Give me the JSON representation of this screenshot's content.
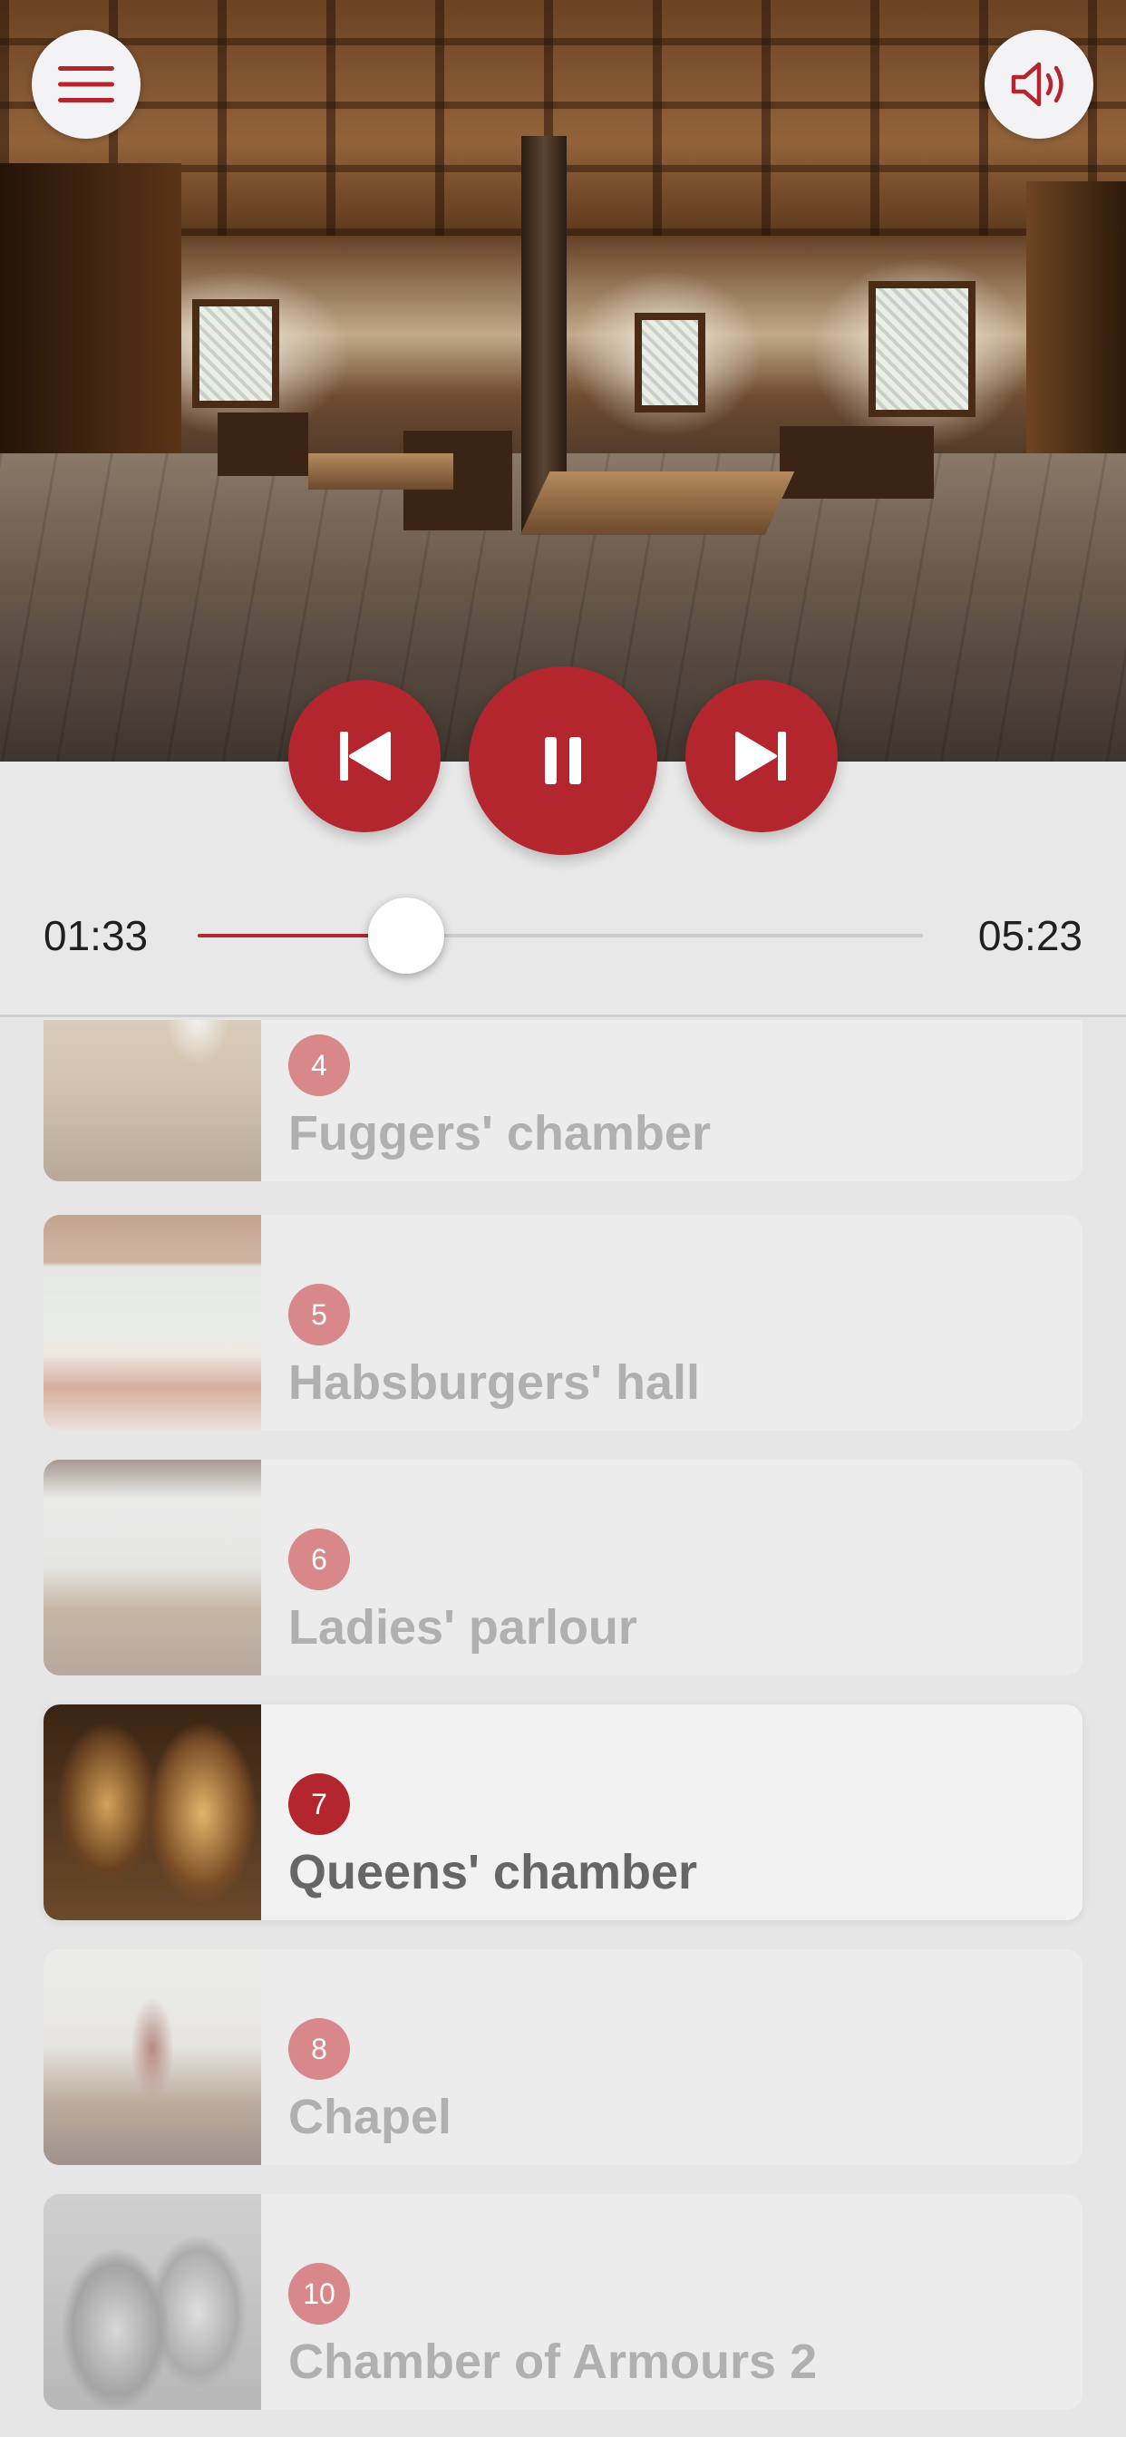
{
  "hero": {
    "image_alt": "castle hall interior with wooden coffered ceiling",
    "menu_icon": "hamburger-menu-icon",
    "sound_icon": "speaker-volume-icon"
  },
  "player": {
    "current_time": "01:33",
    "total_time": "05:23",
    "progress": 0.288,
    "accent_color": "#b3262d",
    "prev_icon": "skip-previous-icon",
    "pause_icon": "pause-icon",
    "next_icon": "skip-next-icon"
  },
  "stops": [
    {
      "number": "4",
      "title": "Fuggers' chamber",
      "active": false
    },
    {
      "number": "5",
      "title": "Habsburgers' hall",
      "active": false
    },
    {
      "number": "6",
      "title": "Ladies' parlour",
      "active": false
    },
    {
      "number": "7",
      "title": "Queens' chamber",
      "active": true
    },
    {
      "number": "8",
      "title": "Chapel",
      "active": false
    },
    {
      "number": "10",
      "title": "Chamber of Armours 2",
      "active": false
    }
  ]
}
